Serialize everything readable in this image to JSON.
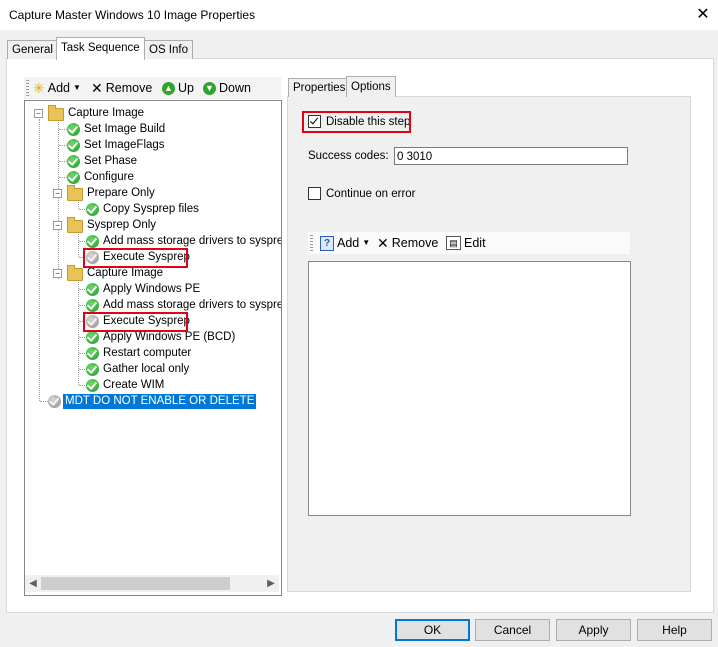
{
  "window": {
    "title": "Capture Master Windows 10 Image Properties",
    "close_icon": "close-icon"
  },
  "tabs": [
    {
      "label": "General",
      "active": false
    },
    {
      "label": "Task Sequence",
      "active": true
    },
    {
      "label": "OS Info",
      "active": false
    }
  ],
  "left_toolbar": {
    "add_label": "Add",
    "remove_label": "Remove",
    "up_label": "Up",
    "down_label": "Down"
  },
  "tree": {
    "capture_image_root": "Capture Image",
    "set_image_build": "Set Image Build",
    "set_image_flags": "Set ImageFlags",
    "set_phase": "Set Phase",
    "configure": "Configure",
    "prepare_only": "Prepare Only",
    "copy_sysprep_files": "Copy Sysprep files",
    "sysprep_only": "Sysprep Only",
    "add_mass_storage_1": "Add mass storage drivers to sysprep.ir",
    "execute_sysprep_1": "Execute Sysprep",
    "capture_image_group": "Capture Image",
    "apply_windows_pe": "Apply Windows PE",
    "add_mass_storage_2": "Add mass storage drivers to sysprep.ir",
    "execute_sysprep_2": "Execute Sysprep",
    "apply_windows_pe_bcd": "Apply Windows PE (BCD)",
    "restart_computer": "Restart computer",
    "gather_local_only": "Gather local only",
    "create_wim": "Create WIM",
    "mdt_do_not_enable": "MDT DO NOT ENABLE OR DELETE"
  },
  "subtabs": [
    {
      "label": "Properties",
      "active": false
    },
    {
      "label": "Options",
      "active": true
    }
  ],
  "options": {
    "disable_step_label": "Disable this step",
    "disable_step_checked": true,
    "success_codes_label": "Success codes:",
    "success_codes_value": "0 3010",
    "continue_on_error_label": "Continue on error",
    "continue_on_error_checked": false
  },
  "conditions_toolbar": {
    "add_label": "Add",
    "remove_label": "Remove",
    "edit_label": "Edit"
  },
  "buttons": {
    "ok": "OK",
    "cancel": "Cancel",
    "apply": "Apply",
    "help": "Help"
  },
  "colors": {
    "highlight_red": "#e3001b",
    "selection_blue": "#0078d7"
  }
}
